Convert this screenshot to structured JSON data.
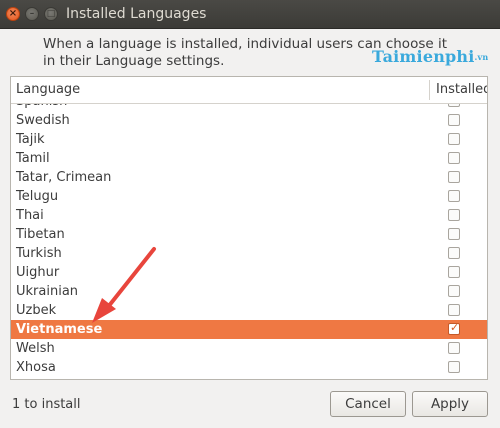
{
  "window": {
    "title": "Installed Languages"
  },
  "description": "When a language is installed, individual users can choose it in their Language settings.",
  "watermark": {
    "main": "Taimienphi",
    "suffix": ".vn"
  },
  "table": {
    "headers": {
      "language": "Language",
      "installed": "Installed"
    },
    "rows": [
      {
        "name": "Spanish",
        "installed": false
      },
      {
        "name": "Swedish",
        "installed": false
      },
      {
        "name": "Tajik",
        "installed": false
      },
      {
        "name": "Tamil",
        "installed": false
      },
      {
        "name": "Tatar, Crimean",
        "installed": false
      },
      {
        "name": "Telugu",
        "installed": false
      },
      {
        "name": "Thai",
        "installed": false
      },
      {
        "name": "Tibetan",
        "installed": false
      },
      {
        "name": "Turkish",
        "installed": false
      },
      {
        "name": "Uighur",
        "installed": false
      },
      {
        "name": "Ukrainian",
        "installed": false
      },
      {
        "name": "Uzbek",
        "installed": false
      },
      {
        "name": "Vietnamese",
        "installed": true,
        "selected": true
      },
      {
        "name": "Welsh",
        "installed": false
      },
      {
        "name": "Xhosa",
        "installed": false
      }
    ]
  },
  "status": "1 to install",
  "buttons": {
    "cancel": "Cancel",
    "apply": "Apply"
  },
  "colors": {
    "selection": "#ef7843",
    "annotation_arrow": "#e8453c",
    "titlebar": "#3c3b37"
  },
  "icons": {
    "close": "close-icon",
    "minimize": "minimize-icon",
    "maximize": "maximize-icon"
  }
}
